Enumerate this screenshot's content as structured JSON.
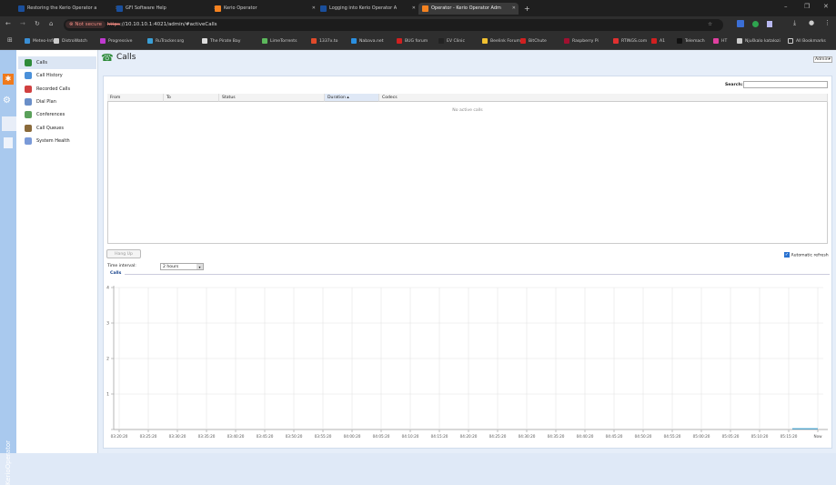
{
  "browser": {
    "tabs": [
      {
        "title": "Restoring the Kerio Operator a",
        "color": "#1a4f9c"
      },
      {
        "title": "GFI Software Help",
        "color": "#1a4f9c"
      },
      {
        "title": "Kerio Operator",
        "color": "#f58220"
      },
      {
        "title": "Logging into Kerio Operator A",
        "color": "#1a4f9c"
      },
      {
        "title": "Operator - Kerio Operator Adm",
        "color": "#f58220"
      }
    ],
    "new_tab": "+",
    "security": "Not secure",
    "url_scheme": "https",
    "url_rest": "://10.10.10.1:4021/admin/#activeCalls",
    "bookmarks": [
      {
        "label": "Meteo-Info",
        "color": "#3a8fd6"
      },
      {
        "label": "DistroWatch",
        "color": "#ccc"
      },
      {
        "label": "Progressive",
        "color": "#c03ad0"
      },
      {
        "label": "RuTracker.org",
        "color": "#3a9fd6"
      },
      {
        "label": "The Pirate Bay",
        "color": "#ddd"
      },
      {
        "label": "LimeTorrents",
        "color": "#5cb85c"
      },
      {
        "label": "1337x.to",
        "color": "#e04a2a"
      },
      {
        "label": "Nabava.net",
        "color": "#2a8fe0"
      },
      {
        "label": "BUG forum",
        "color": "#d02020"
      },
      {
        "label": "EV Clinic",
        "color": "#222"
      },
      {
        "label": "Beelink Forum",
        "color": "#f0c030"
      },
      {
        "label": "BitChute",
        "color": "#d02020"
      },
      {
        "label": "Raspberry Pi",
        "color": "#a01030"
      },
      {
        "label": "RTINGS.com",
        "color": "#e03030"
      },
      {
        "label": "A1",
        "color": "#d02020"
      },
      {
        "label": "Telemach",
        "color": "#111"
      },
      {
        "label": "HT",
        "color": "#e040a0"
      },
      {
        "label": "Njuškalo katalozi",
        "color": "#ccc"
      }
    ],
    "all_bookmarks": "All Bookmarks"
  },
  "app": {
    "brand": "KerioOperator",
    "sidebar": [
      {
        "label": "Calls",
        "color": "#2e8b3a"
      },
      {
        "label": "Call History",
        "color": "#4a90d9"
      },
      {
        "label": "Recorded Calls",
        "color": "#d04040"
      },
      {
        "label": "Dial Plan",
        "color": "#6a8fc8"
      },
      {
        "label": "Conferences",
        "color": "#5aa05a"
      },
      {
        "label": "Call Queues",
        "color": "#8a6a3a"
      },
      {
        "label": "System Health",
        "color": "#7a9ad8"
      }
    ],
    "page_title": "Calls",
    "user_menu": "Admin",
    "search_label": "Search:",
    "search_value": "",
    "columns": [
      "From",
      "To",
      "Status",
      "Duration ▴",
      "Codecs"
    ],
    "empty_text": "No active calls",
    "hang_up": "Hang Up",
    "auto_refresh": "Automatic refresh",
    "auto_refresh_checked": true,
    "time_interval_label": "Time interval:",
    "time_interval_value": "2 hours",
    "chart_legend": "Calls"
  },
  "chart_data": {
    "type": "line",
    "title": "Calls",
    "ylim": [
      0,
      4
    ],
    "yticks": [
      "0",
      "1",
      "2",
      "3",
      "4"
    ],
    "xticks": [
      "03:20:20",
      "03:25:20",
      "03:30:20",
      "03:35:20",
      "03:40:20",
      "03:45:20",
      "03:50:20",
      "03:55:20",
      "04:00:20",
      "04:05:20",
      "04:10:20",
      "04:15:20",
      "04:20:20",
      "04:25:20",
      "04:30:20",
      "04:35:20",
      "04:40:20",
      "04:45:20",
      "04:50:20",
      "04:55:20",
      "05:00:20",
      "05:05:20",
      "05:10:20",
      "05:15:20",
      "Now"
    ],
    "series": [
      {
        "x": [
          "05:15:20",
          "Now"
        ],
        "values": [
          0,
          0
        ]
      }
    ],
    "grid": true,
    "line_color": "#3aa0d0"
  }
}
